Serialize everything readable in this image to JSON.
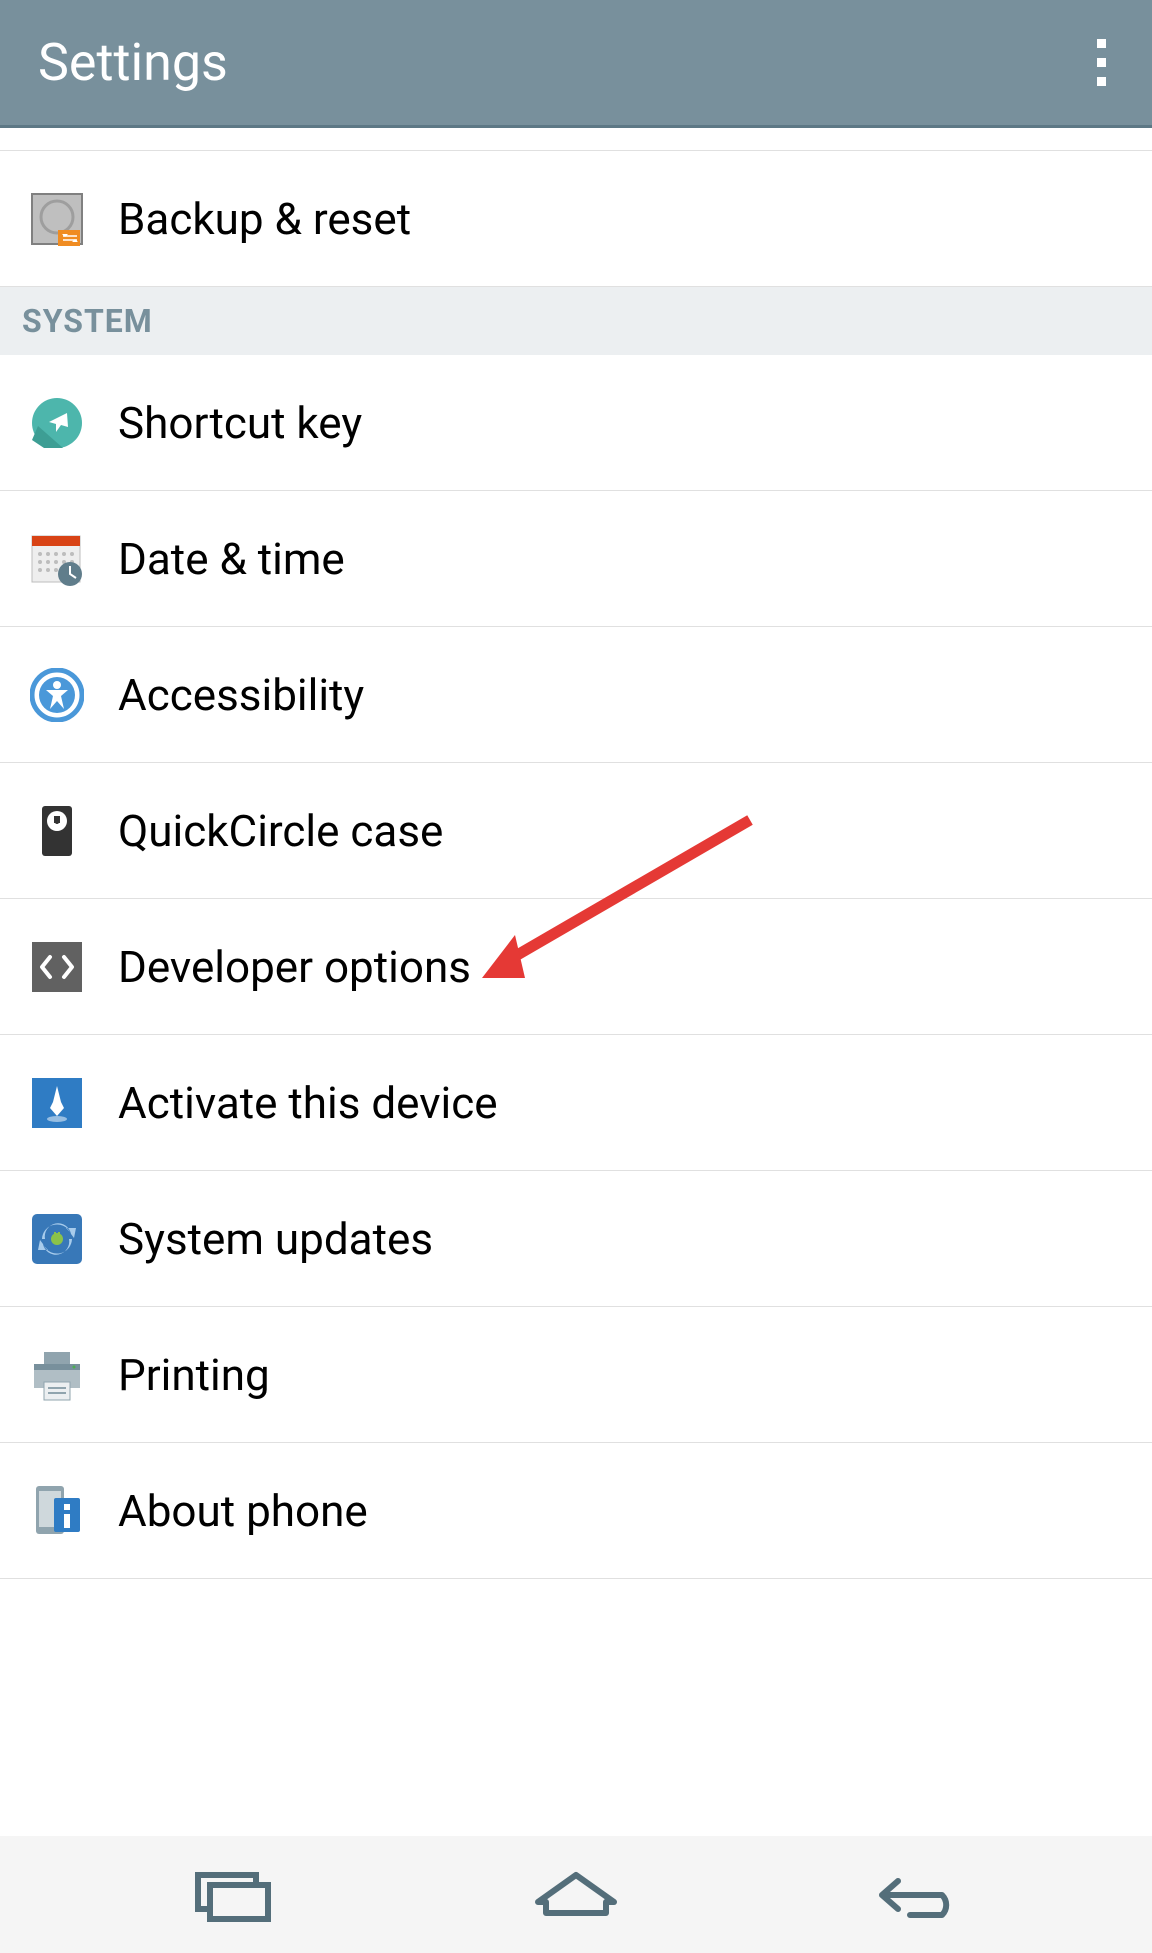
{
  "header": {
    "title": "Settings"
  },
  "items": [
    {
      "label": "Backup & reset",
      "icon": "backup-reset-icon"
    }
  ],
  "section": {
    "label": "SYSTEM"
  },
  "system_items": [
    {
      "label": "Shortcut key",
      "icon": "shortcut-icon"
    },
    {
      "label": "Date & time",
      "icon": "date-time-icon"
    },
    {
      "label": "Accessibility",
      "icon": "accessibility-icon"
    },
    {
      "label": "QuickCircle case",
      "icon": "quickcircle-icon"
    },
    {
      "label": "Developer options",
      "icon": "developer-icon"
    },
    {
      "label": "Activate this device",
      "icon": "activate-icon"
    },
    {
      "label": "System updates",
      "icon": "updates-icon"
    },
    {
      "label": "Printing",
      "icon": "printing-icon"
    },
    {
      "label": "About phone",
      "icon": "about-icon"
    }
  ]
}
